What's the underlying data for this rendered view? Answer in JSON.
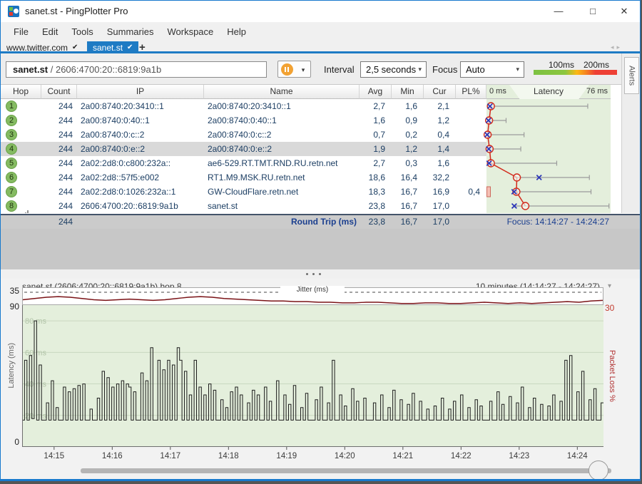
{
  "window": {
    "title": "sanet.st - PingPlotter Pro",
    "minimize": "—",
    "maximize": "□",
    "close": "✕"
  },
  "menu": {
    "items": [
      "File",
      "Edit",
      "Tools",
      "Summaries",
      "Workspace",
      "Help"
    ]
  },
  "tabs": {
    "items": [
      {
        "label": "www.twitter.com",
        "check": "✔",
        "active": false
      },
      {
        "label": "sanet.st",
        "check": "✔",
        "active": true
      }
    ],
    "new_tab": "+",
    "nav_back": "◂",
    "nav_fwd": "▸"
  },
  "toolbar": {
    "target_host": "sanet.st",
    "target_rest": " / 2606:4700:20::6819:9a1b",
    "interval_label": "Interval",
    "interval_value": "2,5 seconds",
    "focus_label": "Focus",
    "focus_value": "Auto",
    "legend_100": "100ms",
    "legend_200": "200ms",
    "legend_colors": [
      "#7cc142",
      "#fdb814",
      "#ee4035"
    ],
    "dropdown_caret": "▾"
  },
  "alerts_label": "Alerts",
  "table": {
    "headers": [
      "Hop",
      "Count",
      "IP",
      "Name",
      "Avg",
      "Min",
      "Cur",
      "PL%"
    ],
    "latency_min_label": "0 ms",
    "latency_title": "Latency",
    "latency_max_label": "76 ms",
    "latency_axis_max_ms": 76,
    "rows": [
      {
        "hop": "1",
        "count": "244",
        "ip": "2a00:8740:20:3410::1",
        "name": "2a00:8740:20:3410::1",
        "avg": "2,7",
        "min": "1,6",
        "cur": "2,1",
        "pl": "",
        "avg_ms": 2.7,
        "min_ms": 1.6,
        "cur_ms": 2.1,
        "max_ms": 62,
        "selected": false,
        "focused": false,
        "loss_indicator": false
      },
      {
        "hop": "2",
        "count": "244",
        "ip": "2a00:8740:0:40::1",
        "name": "2a00:8740:0:40::1",
        "avg": "1,6",
        "min": "0,9",
        "cur": "1,2",
        "pl": "",
        "avg_ms": 1.6,
        "min_ms": 0.9,
        "cur_ms": 1.2,
        "max_ms": 12,
        "selected": false,
        "focused": false,
        "loss_indicator": false
      },
      {
        "hop": "3",
        "count": "244",
        "ip": "2a00:8740:0:c::2",
        "name": "2a00:8740:0:c::2",
        "avg": "0,7",
        "min": "0,2",
        "cur": "0,4",
        "pl": "",
        "avg_ms": 0.7,
        "min_ms": 0.2,
        "cur_ms": 0.4,
        "max_ms": 23,
        "selected": false,
        "focused": false,
        "loss_indicator": false
      },
      {
        "hop": "4",
        "count": "244",
        "ip": "2a00:8740:0:e::2",
        "name": "2a00:8740:0:e::2",
        "avg": "1,9",
        "min": "1,2",
        "cur": "1,4",
        "pl": "",
        "avg_ms": 1.9,
        "min_ms": 1.2,
        "cur_ms": 1.4,
        "max_ms": 21,
        "selected": true,
        "focused": false,
        "loss_indicator": false
      },
      {
        "hop": "5",
        "count": "244",
        "ip": "2a02:2d8:0:c800:232a::",
        "name": "ae6-529.RT.TMT.RND.RU.retn.net",
        "avg": "2,7",
        "min": "0,3",
        "cur": "1,6",
        "pl": "",
        "avg_ms": 2.7,
        "min_ms": 0.3,
        "cur_ms": 1.6,
        "max_ms": 43,
        "selected": false,
        "focused": false,
        "loss_indicator": false
      },
      {
        "hop": "6",
        "count": "244",
        "ip": "2a02:2d8::57f5:e002",
        "name": "RT1.M9.MSK.RU.retn.net",
        "avg": "18,6",
        "min": "16,4",
        "cur": "32,2",
        "pl": "",
        "avg_ms": 18.6,
        "min_ms": 16.4,
        "cur_ms": 32.2,
        "max_ms": 63,
        "selected": false,
        "focused": false,
        "loss_indicator": false
      },
      {
        "hop": "7",
        "count": "244",
        "ip": "2a02:2d8:0:1026:232a::1",
        "name": "GW-CloudFlare.retn.net",
        "avg": "18,3",
        "min": "16,7",
        "cur": "16,9",
        "pl": "0,4",
        "avg_ms": 18.3,
        "min_ms": 16.7,
        "cur_ms": 16.9,
        "max_ms": 64,
        "selected": false,
        "focused": false,
        "loss_indicator": true
      },
      {
        "hop": "8",
        "count": "244",
        "ip": "2606:4700:20::6819:9a1b",
        "name": "sanet.st",
        "avg": "23,8",
        "min": "16,7",
        "cur": "17,0",
        "pl": "",
        "avg_ms": 23.8,
        "min_ms": 16.7,
        "cur_ms": 17.0,
        "max_ms": 75,
        "selected": false,
        "focused": true,
        "loss_indicator": false
      }
    ],
    "footer": {
      "count": "244",
      "label": "Round Trip (ms)",
      "avg": "23,8",
      "min": "16,7",
      "cur": "17,0",
      "focus": "Focus: 14:14:27 - 14:24:27"
    }
  },
  "timeline": {
    "title": "sanet.st (2606:4700:20::6819:9a1b) hop 8",
    "range": "10 minutes (14:14:27 - 14:24:27)",
    "caret": "▾"
  },
  "chart_data": [
    {
      "type": "line",
      "name": "jitter",
      "title": "Jitter (ms)",
      "axis_top_label": "35",
      "axis_max": 35,
      "line_color": "#7a1216",
      "values": [
        29,
        30,
        31,
        31.5,
        31,
        30,
        29,
        28.5,
        29,
        29.5,
        29,
        28.5,
        29,
        30,
        31,
        31.5,
        31,
        30,
        29.5,
        29,
        28.5,
        28,
        28,
        27.5,
        27.5,
        27,
        27,
        26.5,
        26.5,
        27,
        27,
        26.5,
        26,
        26,
        26.5,
        26.5,
        26,
        26,
        26.5,
        27,
        26.5,
        26,
        26.5,
        26,
        26.5,
        27,
        27.5,
        27,
        28,
        28.5
      ]
    },
    {
      "type": "bar",
      "name": "latency-timeline",
      "ylabel": "Latency (ms)",
      "ylabel_right": "Packet Loss %",
      "ylim": [
        0,
        90
      ],
      "right_ylim": [
        0,
        30
      ],
      "y_top_label": "90",
      "y_bottom_label": "0",
      "right_top_label": "30",
      "gridlines_ms": [
        20,
        40,
        60,
        80
      ],
      "gridline_labels": [
        "20 ms",
        "40 ms",
        "60 ms",
        "80 ms"
      ],
      "x_ticks": [
        "14:15",
        "14:16",
        "14:17",
        "14:18",
        "14:19",
        "14:20",
        "14:21",
        "14:22",
        "14:23",
        "14:24"
      ],
      "start_time": "14:14:27",
      "end_time": "14:24:27",
      "sample_interval_s": 2.5,
      "bar_color": "#1c1c1c",
      "bg_color": "#e4efdc",
      "values": [
        17,
        55,
        17,
        58,
        18,
        80,
        17,
        52,
        17,
        17,
        28,
        17,
        42,
        17,
        25,
        17,
        17,
        38,
        17,
        35,
        17,
        37,
        17,
        39,
        17,
        40,
        17,
        17,
        24,
        17,
        17,
        31,
        17,
        48,
        17,
        44,
        17,
        38,
        17,
        40,
        17,
        42,
        17,
        40,
        38,
        17,
        35,
        17,
        17,
        47,
        17,
        42,
        17,
        63,
        17,
        17,
        55,
        17,
        49,
        17,
        55,
        17,
        52,
        17,
        63,
        55,
        17,
        48,
        17,
        33,
        17,
        55,
        17,
        38,
        17,
        33,
        17,
        40,
        17,
        36,
        17,
        17,
        30,
        17,
        25,
        17,
        35,
        17,
        38,
        17,
        33,
        17,
        17,
        28,
        17,
        36,
        17,
        33,
        17,
        17,
        38,
        17,
        29,
        17,
        17,
        42,
        17,
        17,
        33,
        17,
        27,
        17,
        39,
        17,
        17,
        25,
        17,
        34,
        17,
        17,
        17,
        30,
        17,
        38,
        17,
        17,
        28,
        17,
        55,
        17,
        17,
        33,
        17,
        26,
        17,
        17,
        37,
        17,
        29,
        17,
        17,
        31,
        17,
        17,
        17,
        28,
        17,
        17,
        33,
        17,
        17,
        25,
        17,
        36,
        17,
        17,
        30,
        17,
        17,
        27,
        17,
        34,
        17,
        17,
        29,
        17,
        17,
        24,
        17,
        17,
        26,
        17,
        17,
        31,
        17,
        17,
        24,
        17,
        29,
        17,
        17,
        33,
        17,
        17,
        25,
        17,
        17,
        30,
        17,
        26,
        17,
        17,
        17,
        29,
        17,
        17,
        35,
        17,
        27,
        17,
        17,
        32,
        17,
        17,
        28,
        17,
        38,
        17,
        17,
        25,
        17,
        31,
        17,
        17,
        27,
        17,
        17,
        26,
        17,
        33,
        17,
        17,
        29,
        17,
        55,
        17,
        58,
        17,
        17,
        35,
        17,
        48,
        17,
        17,
        30,
        17,
        37,
        17,
        17,
        28
      ]
    }
  ]
}
